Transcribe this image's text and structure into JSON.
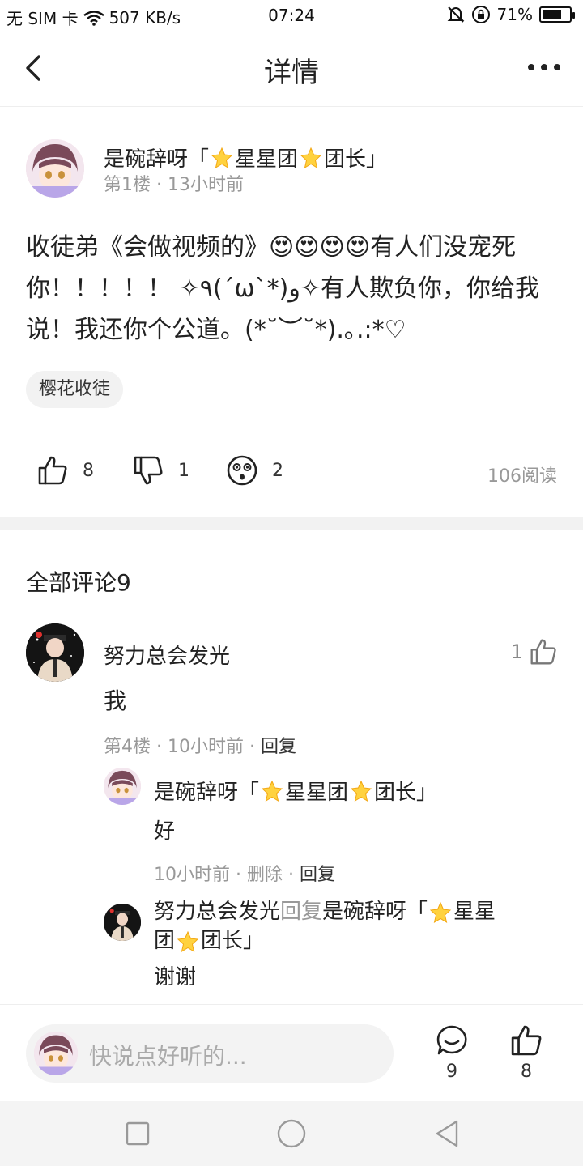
{
  "status_bar": {
    "carrier": "无 SIM 卡",
    "speed": "507 KB/s",
    "time": "07:24",
    "battery": "71%",
    "battery_level": 0.71
  },
  "header": {
    "title": "详情"
  },
  "post": {
    "author": "是碗辞呀「",
    "author_mid": "星星团",
    "author_end": "团长」",
    "meta": "第1楼 · 13小时前",
    "body": "收徒弟《会做视频的》😍😍😍😍有人们没宠死你！！！！！ ✧٩(ˊωˋ*)و✧有人欺负你，你给我说！我还你个公道。(*˘︶˘*).｡.:*♡",
    "tag": "樱花收徒",
    "likes": "8",
    "dislikes": "1",
    "wows": "2",
    "reads": "106阅读"
  },
  "comments": {
    "title": "全部评论9",
    "item": {
      "author": "努力总会发光",
      "likes": "1",
      "text": "我",
      "meta": "第4楼 · 10小时前 · ",
      "reply_label": "回复"
    },
    "reply1": {
      "author": "是碗辞呀「",
      "author_mid": "星星团",
      "author_end": "团长」",
      "text": "好",
      "meta": "10小时前 · ",
      "delete_label": "删除",
      "sep": " · ",
      "reply_label": "回复"
    },
    "reply2": {
      "author": "努力总会发光",
      "reply_word": "回复",
      "target": "是碗辞呀「",
      "target_mid": "星星",
      "target_mid2": "团",
      "target_end": "团长」",
      "text": "谢谢"
    }
  },
  "bottom_bar": {
    "placeholder": "快说点好听的...",
    "comment_count": "9",
    "like_count": "8"
  },
  "icons": {
    "back": "chevron-left-icon",
    "more": "more-dots-icon",
    "like": "thumbs-up-icon",
    "dislike": "thumbs-down-icon",
    "wow": "surprised-face-icon",
    "comment": "chat-bubble-icon",
    "star": "star-emoji-icon"
  }
}
